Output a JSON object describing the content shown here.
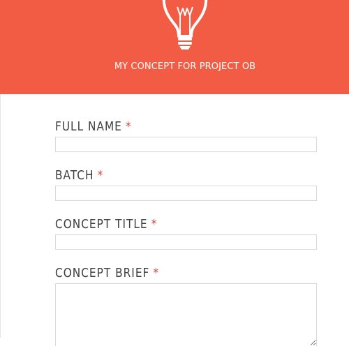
{
  "form": {
    "title": "MY CONCEPT FOR PROJECT OB",
    "icon": "lightbulb-icon",
    "accent_color": "#F25C44",
    "required_color": "#D9483B",
    "required_marker": "*"
  },
  "fields": [
    {
      "label": "FULL NAME",
      "value": "",
      "required": true,
      "type": "text"
    },
    {
      "label": "BATCH",
      "value": "",
      "required": true,
      "type": "text"
    },
    {
      "label": "CONCEPT TITLE",
      "value": "",
      "required": true,
      "type": "text"
    },
    {
      "label": "CONCEPT BRIEF",
      "value": "",
      "required": true,
      "type": "textarea"
    }
  ]
}
